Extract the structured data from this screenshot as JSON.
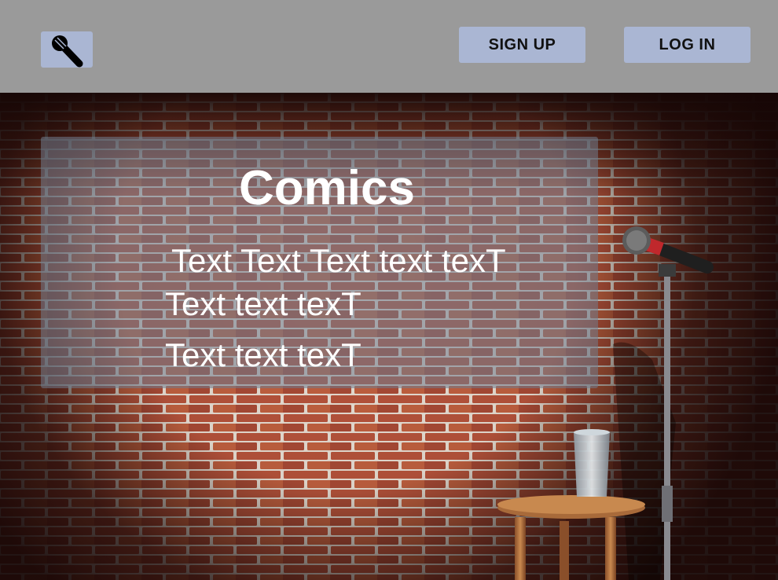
{
  "header": {
    "logo_icon": "microphone-icon",
    "signup_label": "SIGN UP",
    "login_label": "LOG IN"
  },
  "hero": {
    "title": "Comics",
    "lines": [
      "Text Text Text text texT",
      "Text text texT",
      "Text text texT"
    ]
  },
  "colors": {
    "header_bg": "#9a9a9a",
    "button_bg": "#aab6d3",
    "panel_overlay": "rgba(112,124,142,0.55)",
    "brick": "#b5503a"
  }
}
